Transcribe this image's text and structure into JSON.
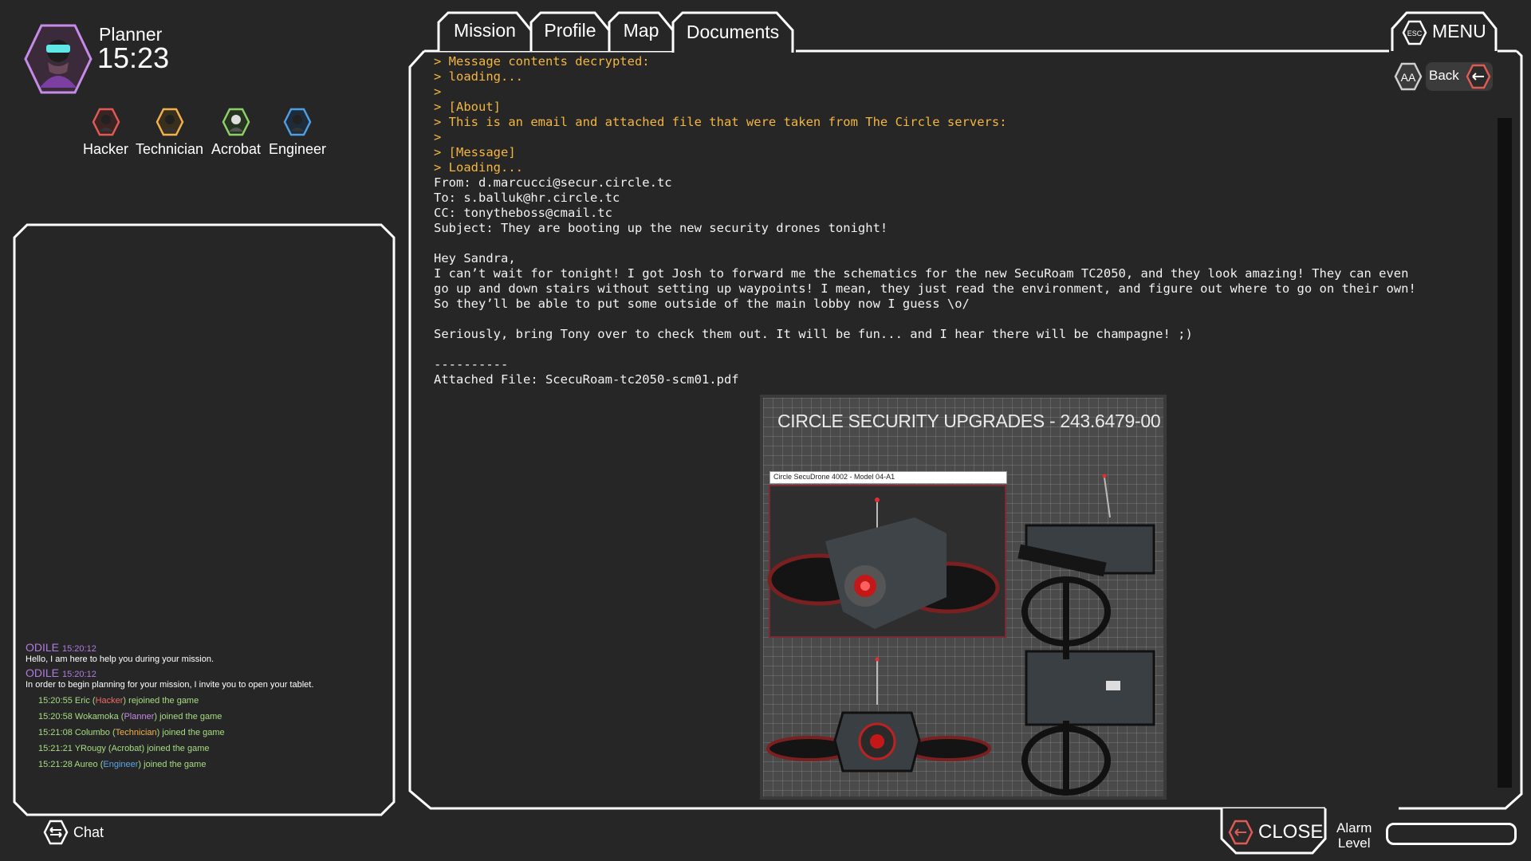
{
  "player": {
    "role": "Planner",
    "clock": "15:23"
  },
  "team": [
    {
      "label": "Hacker",
      "color": "#e05a55",
      "icon": "hacker-hex-icon"
    },
    {
      "label": "Technician",
      "color": "#f0b04c",
      "icon": "technician-hex-icon"
    },
    {
      "label": "Acrobat",
      "color": "#8fcf6a",
      "icon": "acrobat-hex-icon"
    },
    {
      "label": "Engineer",
      "color": "#4f9ee0",
      "icon": "engineer-hex-icon"
    }
  ],
  "tabs": [
    {
      "label": "Mission",
      "active": false
    },
    {
      "label": "Profile",
      "active": false
    },
    {
      "label": "Map",
      "active": false
    },
    {
      "label": "Documents",
      "active": true
    }
  ],
  "menu": {
    "label": "MENU",
    "esc_label": "ESC"
  },
  "text_size": {
    "label": "AA"
  },
  "back": {
    "label": "Back"
  },
  "close": {
    "label": "CLOSE"
  },
  "alarm": {
    "line1": "Alarm",
    "line2": "Level",
    "level": 0
  },
  "chat": {
    "button_label": "Chat",
    "messages": [
      {
        "author": "ODILE",
        "time": "15:20:12",
        "text": "Hello, I am here to help you during your mission."
      },
      {
        "author": "ODILE",
        "time": "15:20:12",
        "text": "In order to begin planning for your mission, I invite you to open your tablet."
      }
    ],
    "events": [
      {
        "time": "15:20:55",
        "name": "Eric",
        "role": "Hacker",
        "action": "rejoined the game"
      },
      {
        "time": "15:20:58",
        "name": "Wokamoka",
        "role": "Planner",
        "action": "joined the game"
      },
      {
        "time": "15:21:08",
        "name": "Columbo",
        "role": "Technician",
        "action": "joined the game"
      },
      {
        "time": "15:21:21",
        "name": "YRougy",
        "role": "Acrobat",
        "action": "joined the game"
      },
      {
        "time": "15:21:28",
        "name": "Aureo",
        "role": "Engineer",
        "action": "joined the game"
      }
    ]
  },
  "document": {
    "lines": [
      {
        "type": "sys",
        "text": "> Message contents decrypted:"
      },
      {
        "type": "sys",
        "text": "> loading..."
      },
      {
        "type": "sys",
        "text": ">"
      },
      {
        "type": "sys",
        "text": "> [About]"
      },
      {
        "type": "sys",
        "text": "> This is an email and attached file that were taken from The Circle servers:"
      },
      {
        "type": "sys",
        "text": ">"
      },
      {
        "type": "sys",
        "text": "> [Message]"
      },
      {
        "type": "sys",
        "text": "> Loading..."
      },
      {
        "type": "plain",
        "text": "From: d.marcucci@secur.circle.tc"
      },
      {
        "type": "plain",
        "text": "To: s.balluk@hr.circle.tc"
      },
      {
        "type": "plain",
        "text": "CC: tonytheboss@cmail.tc"
      },
      {
        "type": "plain",
        "text": "Subject: They are booting up the new security drones tonight!"
      },
      {
        "type": "plain",
        "text": ""
      },
      {
        "type": "plain",
        "text": "Hey Sandra,"
      },
      {
        "type": "plain",
        "text": "I can’t wait for tonight! I got Josh to forward me the schematics for the new SecuRoam TC2050, and they look amazing! They can even"
      },
      {
        "type": "plain",
        "text": "go up and down stairs without setting up waypoints! I mean, they just read the environment, and figure out where to go on their own!"
      },
      {
        "type": "plain",
        "text": "So they’ll be able to put some outside of the main lobby now I guess \\o/"
      },
      {
        "type": "plain",
        "text": ""
      },
      {
        "type": "plain",
        "text": "Seriously, bring Tony over to check them out. It will be fun... and I hear there will be champagne! ;)"
      },
      {
        "type": "plain",
        "text": ""
      },
      {
        "type": "plain",
        "text": "----------"
      },
      {
        "type": "plain",
        "text": "Attached File: ScecuRoam-tc2050-scm01.pdf"
      }
    ],
    "attachment": {
      "title": "CIRCLE SECURITY UPGRADES - 243.6479-00",
      "caption": "Circle SecuDrone 4002 - Model 04-A1"
    }
  },
  "colors": {
    "background": "#262626",
    "system_text": "#f3b640",
    "odile": "#b07ae0",
    "event": "#a7dc84",
    "close_accent": "#e05a55"
  }
}
